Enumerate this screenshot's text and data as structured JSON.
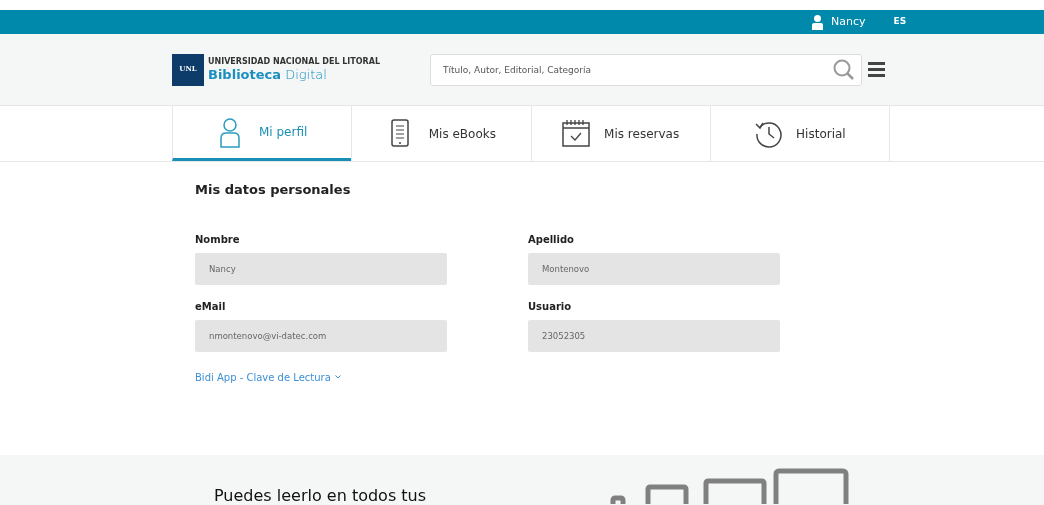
{
  "top_bar": {
    "user": "Nancy",
    "language": "ES"
  },
  "logo": {
    "badge": "UNL",
    "university": "UNIVERSIDAD NACIONAL DEL LITORAL",
    "name_bold": "Biblioteca",
    "name_light": "Digital"
  },
  "search": {
    "placeholder": "Título, Autor, Editorial, Categoría"
  },
  "tabs": [
    {
      "kind": "person",
      "label": "Mi perfil",
      "selected": true
    },
    {
      "kind": "ebook",
      "label": "Mis eBooks",
      "selected": false
    },
    {
      "kind": "calendar",
      "label": "Mis reservas",
      "selected": false
    },
    {
      "kind": "history",
      "label": "Historial",
      "selected": false
    }
  ],
  "section_title": "Mis datos personales",
  "fields": [
    {
      "label": "Nombre",
      "value": "Nancy"
    },
    {
      "label": "Apellido",
      "value": "Montenovo"
    },
    {
      "label": "eMail",
      "value": "nmontenovo@vi-datec.com"
    },
    {
      "label": "Usuario",
      "value": "23052305"
    }
  ],
  "expander": {
    "label": "Bidi App - Clave de Lectura",
    "expanded": false
  },
  "promo": {
    "heading": "Puedes leerlo en todos tus"
  }
}
